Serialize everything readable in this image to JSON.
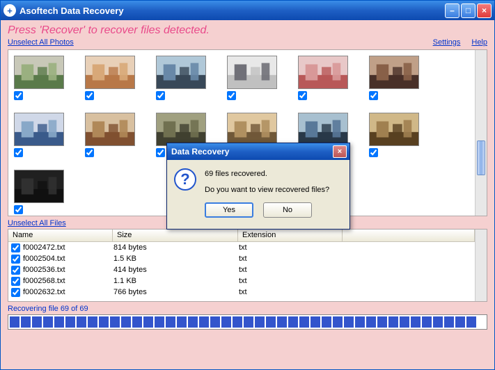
{
  "titlebar": {
    "app_name": "Asoftech Data Recovery"
  },
  "instruction": "Press 'Recover' to recover files detected.",
  "links": {
    "unselect_photos": "Unselect All Photos",
    "unselect_files": "Unselect All Files",
    "settings": "Settings",
    "help": "Help"
  },
  "file_headers": {
    "name": "Name",
    "size": "Size",
    "ext": "Extension"
  },
  "files": [
    {
      "name": "f0002472.txt",
      "size": "814 bytes",
      "ext": "txt"
    },
    {
      "name": "f0002504.txt",
      "size": "1.5 KB",
      "ext": "txt"
    },
    {
      "name": "f0002536.txt",
      "size": "414 bytes",
      "ext": "txt"
    },
    {
      "name": "f0002568.txt",
      "size": "1.1 KB",
      "ext": "txt"
    },
    {
      "name": "f0002632.txt",
      "size": "766 bytes",
      "ext": "txt"
    }
  ],
  "status": "Recovering file 69 of 69",
  "dialog": {
    "title": "Data Recovery",
    "message1": "69 files recovered.",
    "message2": "Do you want to view recovered files?",
    "yes": "Yes",
    "no": "No"
  },
  "photo_count": 13,
  "progress_blocks": 42
}
